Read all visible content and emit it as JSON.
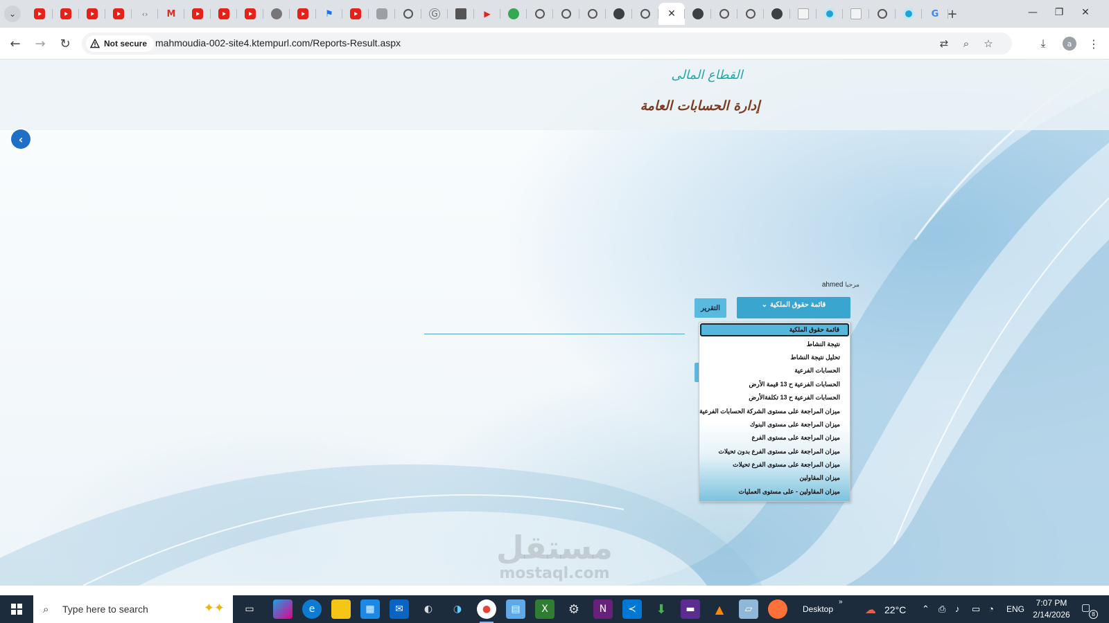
{
  "browser": {
    "tabs": [
      {
        "icon": "youtube-icon"
      },
      {
        "icon": "youtube-icon"
      },
      {
        "icon": "youtube-icon"
      },
      {
        "icon": "youtube-icon"
      },
      {
        "icon": "code-icon"
      },
      {
        "icon": "gmail-icon"
      },
      {
        "icon": "youtube-icon"
      },
      {
        "icon": "youtube-icon"
      },
      {
        "icon": "youtube-icon"
      },
      {
        "icon": "facebook-icon"
      },
      {
        "icon": "youtube-icon"
      },
      {
        "icon": "flag-icon"
      },
      {
        "icon": "youtube-icon"
      },
      {
        "icon": "grey-icon"
      },
      {
        "icon": "chatgpt-icon"
      },
      {
        "icon": "google-g-icon"
      },
      {
        "icon": "grid-icon"
      },
      {
        "icon": "play-icon"
      },
      {
        "icon": "green-circle-icon"
      },
      {
        "icon": "globe-icon"
      },
      {
        "icon": "globe-icon"
      },
      {
        "icon": "chatgpt-icon"
      },
      {
        "icon": "feather-icon"
      },
      {
        "icon": "globe-icon"
      },
      {
        "icon": "close-icon",
        "active": true
      },
      {
        "icon": "feather-icon"
      },
      {
        "icon": "globe-icon"
      },
      {
        "icon": "globe-icon"
      },
      {
        "icon": "feather-icon"
      },
      {
        "icon": "doc-icon"
      },
      {
        "icon": "teal-circle-icon"
      },
      {
        "icon": "doc-icon"
      },
      {
        "icon": "chatgpt-icon"
      },
      {
        "icon": "teal-circle-icon"
      },
      {
        "icon": "google-icon"
      }
    ],
    "new_tab": "+",
    "security_label": "Not secure",
    "url": "mahmoudia-002-site4.ktempurl.com/Reports-Result.aspx",
    "profile_initial": "a",
    "accent": "#1a73e8"
  },
  "page": {
    "sector_title": "القطاع المالى",
    "dept_title": "إدارة الحسابات العامة",
    "welcome_user": "ahmed",
    "welcome_text": "مرحبا",
    "report_button": "التقرير",
    "selected_report": "قائمة حقوق الملكية",
    "select_arrow": "⌄",
    "report_options": [
      "قائمة حقوق الملكية",
      "نتيجة النشاط",
      "تحليل نتيجة النشاط",
      "الحسابات الفرعية",
      "الحسابات الفرعية ح 13 قيمة الأرض",
      "الحسابات الفرعية ح 13 تكلفةالأرض",
      "ميزان المراجعة على مستوى الشركة الحسابات الفرعية",
      "ميزان المراجعة على مستوى البنوك",
      "ميزان المراجعة على مستوى الفرع",
      "ميزان المراجعة على مستوى الفرع بدون تحيلات",
      "ميزان المراجعة على مستوى الفرع تحيلات",
      "ميزان المقاولين",
      "ميزان المقاولين - على مستوى العمليات"
    ],
    "watermark_ar": "مستقل",
    "watermark_en": "mostaql.com",
    "header_title_color": "#26a6a6",
    "header_dept_color": "#7a3d22",
    "button_color": "#3aa6cf"
  },
  "taskbar": {
    "search_placeholder": "Type here to search",
    "desktop_label": "Desktop",
    "weather": "22°C",
    "language": "ENG",
    "time": "7:07 PM",
    "date": "2/14/2026",
    "notification_count": "8"
  }
}
